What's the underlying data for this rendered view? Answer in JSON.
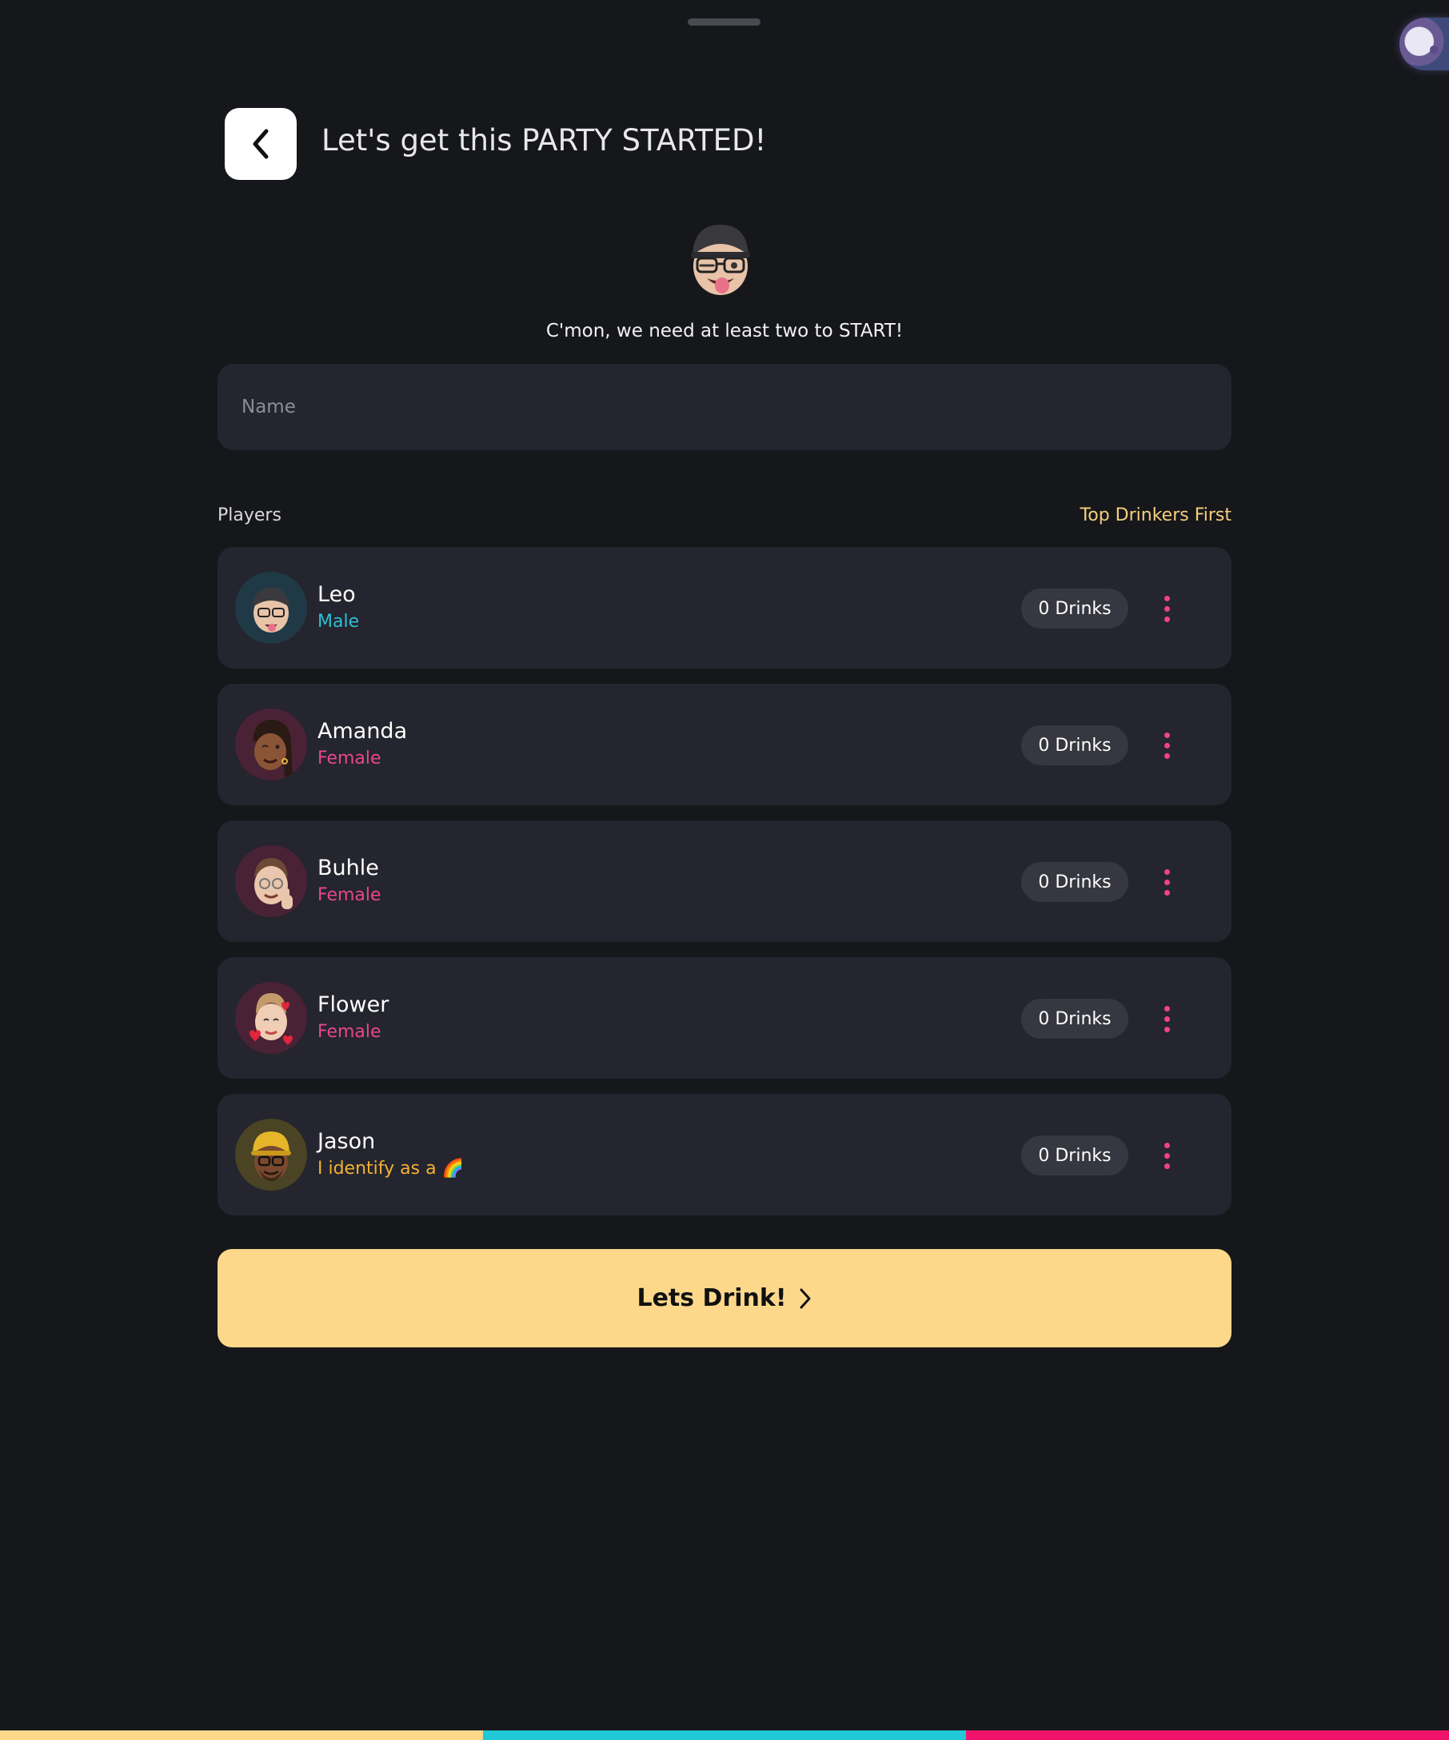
{
  "header": {
    "title": "Let's get this PARTY STARTED!"
  },
  "hero": {
    "avatar": "memoji-wink-tongue",
    "hint": "C'mon, we need at least two to START!"
  },
  "name_input": {
    "placeholder": "Name",
    "value": ""
  },
  "players_section": {
    "label": "Players",
    "sort_label": "Top Drinkers First"
  },
  "players": [
    {
      "name": "Leo",
      "gender": "Male",
      "gender_color": "#2fbfd6",
      "avatar_bg": "#1f3a46",
      "avatar": "memoji-cap-glasses",
      "drinks": "0 Drinks"
    },
    {
      "name": "Amanda",
      "gender": "Female",
      "gender_color": "#e8468c",
      "avatar_bg": "#4a2235",
      "avatar": "memoji-braids-wink",
      "drinks": "0 Drinks"
    },
    {
      "name": "Buhle",
      "gender": "Female",
      "gender_color": "#e8468c",
      "avatar_bg": "#4a2235",
      "avatar": "memoji-glasses-thumbs-up",
      "drinks": "0 Drinks"
    },
    {
      "name": "Flower",
      "gender": "Female",
      "gender_color": "#e8468c",
      "avatar_bg": "#4a2235",
      "avatar": "memoji-hearts",
      "drinks": "0 Drinks"
    },
    {
      "name": "Jason",
      "gender": "I identify as a 🌈",
      "gender_color": "#f2b233",
      "avatar_bg": "#4a4324",
      "avatar": "memoji-yellow-cap",
      "drinks": "0 Drinks"
    }
  ],
  "cta": {
    "label": "Lets Drink!"
  },
  "colors": {
    "background": "#16171b",
    "card": "#24252e",
    "accent_yellow": "#fdd88b",
    "accent_pink": "#f0418f",
    "accent_cyan": "#20c8d8"
  },
  "bottom_bar_colors": [
    "#fdd88b",
    "#20c8d8",
    "#f0136b"
  ]
}
